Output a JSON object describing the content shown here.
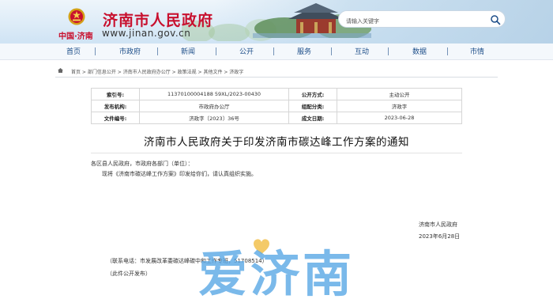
{
  "header": {
    "title": "济南市人民政府",
    "cn_sub": "中国·济南",
    "url": "www.jinan.gov.cn",
    "search_placeholder": "请输入关键字"
  },
  "nav": [
    "首页",
    "市政府",
    "新闻",
    "公开",
    "服务",
    "互动",
    "数据",
    "市情"
  ],
  "breadcrumb": {
    "items": [
      "首页",
      "部门信息公开",
      "济南市人民政府办公厅",
      "政策法规",
      "其他文件",
      "济政字"
    ]
  },
  "meta": {
    "index_label": "索引号:",
    "index_value": "11370100004188 59XL/2023-00430",
    "open_mode_label": "公开方式:",
    "open_mode_value": "主动公开",
    "issuer_label": "发布机构:",
    "issuer_value": "市政府办公厅",
    "category_label": "组配分类:",
    "category_value": "济政字",
    "doc_no_label": "文件编号:",
    "doc_no_value": "济政字〔2023〕36号",
    "date_label": "成文日期:",
    "date_value": "2023-06-28"
  },
  "document": {
    "title": "济南市人民政府关于印发济南市碳达峰工作方案的通知",
    "salutation": "各区县人民政府，市政府各部门（单位）：",
    "body": "现将《济南市碳达峰工作方案》印发给你们，请认真组织实施。",
    "signature": "济南市人民政府",
    "sign_date": "2023年6月28日",
    "contact": "（联系电话：市发展改革委碳达峰碳中和工作专班，51708514）",
    "publish_note": "（此件公开发布）"
  },
  "watermark": {
    "text": "爱济南",
    "color": "#5aa8e6",
    "heart_color": "#f2c14e"
  },
  "colors": {
    "brand_red": "#c8102e",
    "nav_blue": "#1d4e89"
  }
}
